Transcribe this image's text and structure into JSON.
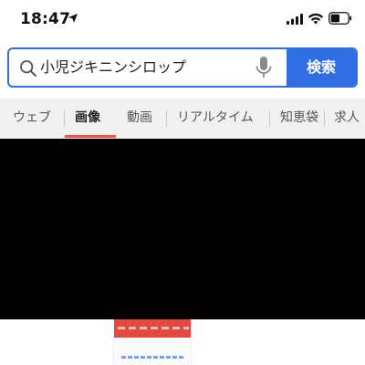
{
  "status_bar": {
    "time": "18:47"
  },
  "search": {
    "query": "小児ジキニンシロップ",
    "button_label": "検索"
  },
  "tabs": [
    {
      "label": "ウェブ",
      "active": false
    },
    {
      "label": "画像",
      "active": true
    },
    {
      "label": "動画",
      "active": false
    },
    {
      "label": "リアルタイム",
      "active": false
    },
    {
      "label": "知恵袋",
      "active": false
    },
    {
      "label": "求人",
      "active": false
    }
  ],
  "colors": {
    "accent": "#2f6ee3",
    "active_tab_underline": "#e8574f"
  },
  "icons": {
    "location": "location-arrow-icon",
    "signal": "cellular-signal-icon",
    "wifi": "wifi-icon",
    "battery": "battery-icon",
    "search": "search-icon",
    "mic": "microphone-icon"
  }
}
